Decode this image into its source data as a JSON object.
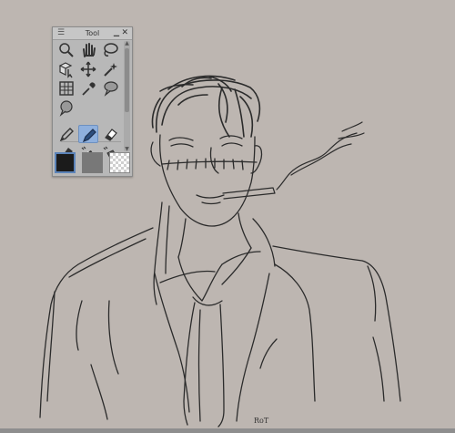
{
  "panel": {
    "title": "Tool",
    "menu_icon": "menu-icon",
    "minimize_icon": "minimize-icon",
    "close_icon": "close-icon"
  },
  "tools": [
    "zoom-tool-icon",
    "hand-tool-icon",
    "lasso-tool-icon",
    "object-tool-icon",
    "move-tool-icon",
    "magic-wand-icon",
    "grid-tool-icon",
    "eyedropper-icon",
    "balloon-tool-icon",
    "speech-balloon-icon",
    "pen-tool-icon",
    "pencil-tool-icon",
    "eraser-icon",
    "brush-tool-icon",
    "fill-bucket-icon",
    "gradient-bucket-icon"
  ],
  "active_tool": "pencil-tool-icon",
  "colors": {
    "main_color": "#1b1b1b",
    "sub_color": "#787878",
    "transparent": "transparent",
    "canvas_background": "#bdb6b1",
    "selection": "#8fb0dd"
  },
  "canvas": {
    "signature": "RoT",
    "subject": "sketch-drawing"
  }
}
